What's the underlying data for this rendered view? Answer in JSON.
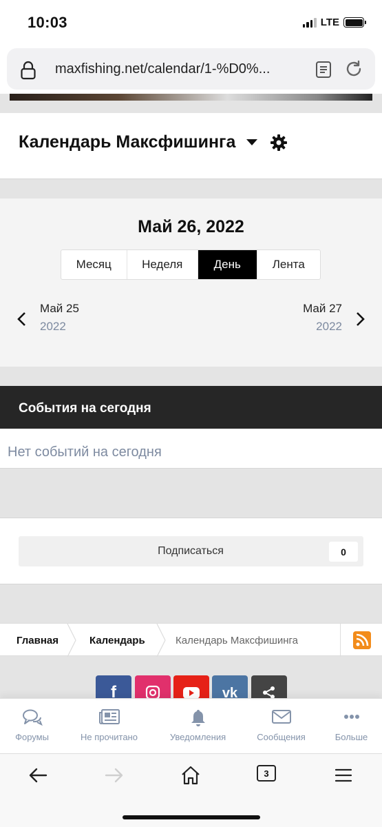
{
  "status": {
    "time": "10:03",
    "network": "LTE"
  },
  "browser": {
    "url": "maxfishing.net/calendar/1-%D0%..."
  },
  "calendar": {
    "title": "Календарь Максфишинга",
    "date": "Май 26, 2022",
    "tabs": [
      {
        "label": "Месяц",
        "active": false
      },
      {
        "label": "Неделя",
        "active": false
      },
      {
        "label": "День",
        "active": true
      },
      {
        "label": "Лента",
        "active": false
      }
    ],
    "prev": {
      "day": "Май 25",
      "year": "2022"
    },
    "next": {
      "day": "Май 27",
      "year": "2022"
    }
  },
  "events": {
    "heading": "События на сегодня",
    "empty": "Нет событий на сегодня"
  },
  "subscribe": {
    "label": "Подписаться",
    "count": "0"
  },
  "breadcrumb": [
    "Главная",
    "Календарь",
    "Календарь Максфишинга"
  ],
  "social": [
    {
      "icon": "facebook-icon",
      "color": "#3b5998"
    },
    {
      "icon": "instagram-icon",
      "color": "#e1306c"
    },
    {
      "icon": "youtube-icon",
      "color": "#e62117"
    },
    {
      "icon": "vk-icon",
      "color": "#4c75a3"
    },
    {
      "icon": "share-icon",
      "color": "#444444"
    }
  ],
  "bottom_nav": [
    {
      "label": "Форумы",
      "icon": "forums-icon"
    },
    {
      "label": "Не прочитано",
      "icon": "unread-icon"
    },
    {
      "label": "Уведомления",
      "icon": "bell-icon"
    },
    {
      "label": "Сообщения",
      "icon": "envelope-icon"
    },
    {
      "label": "Больше",
      "icon": "more-icon"
    }
  ],
  "safari": {
    "tabs_count": "3"
  },
  "colors": {
    "accent_dark": "#000000",
    "muted_text": "#7d8aa0",
    "rss": "#f28c1b"
  }
}
